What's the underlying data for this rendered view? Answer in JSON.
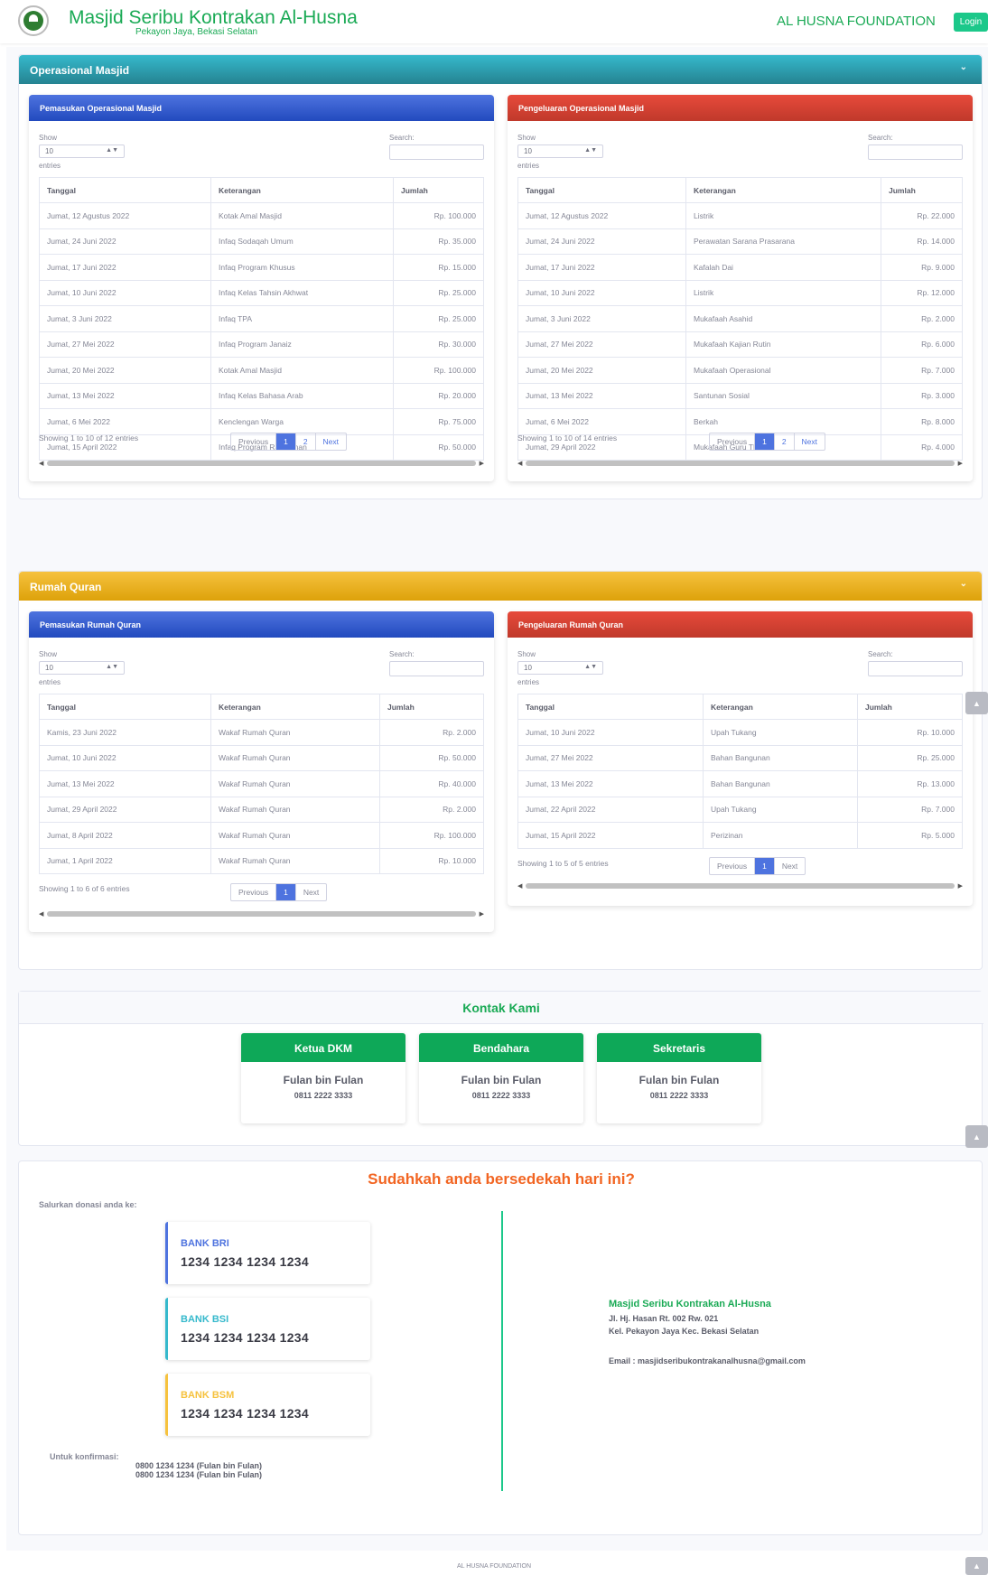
{
  "header": {
    "title": "Masjid Seribu Kontrakan Al-Husna",
    "subtitle": "Pekayon Jaya, Bekasi Selatan",
    "foundation": "AL HUSNA FOUNDATION",
    "login": "Login"
  },
  "common": {
    "show": "Show",
    "entries_value": "10",
    "entries": "entries",
    "search": "Search:",
    "col_tanggal": "Tanggal",
    "col_keterangan": "Keterangan",
    "col_jumlah": "Jumlah",
    "previous": "Previous",
    "next": "Next",
    "page1": "1",
    "page2": "2"
  },
  "operasional": {
    "title": "Operasional Masjid",
    "income": {
      "title": "Pemasukan Operasional Masjid",
      "info": "Showing 1 to 10 of 12 entries",
      "rows": [
        [
          "Jumat, 12 Agustus 2022",
          "Kotak Amal Masjid",
          "Rp. 100.000"
        ],
        [
          "Jumat, 24 Juni 2022",
          "Infaq Sodaqah Umum",
          "Rp. 35.000"
        ],
        [
          "Jumat, 17 Juni 2022",
          "Infaq Program Khusus",
          "Rp. 15.000"
        ],
        [
          "Jumat, 10 Juni 2022",
          "Infaq Kelas Tahsin Akhwat",
          "Rp. 25.000"
        ],
        [
          "Jumat, 3 Juni 2022",
          "Infaq TPA",
          "Rp. 25.000"
        ],
        [
          "Jumat, 27 Mei 2022",
          "Infaq Program Janaiz",
          "Rp. 30.000"
        ],
        [
          "Jumat, 20 Mei 2022",
          "Kotak Amal Masjid",
          "Rp. 100.000"
        ],
        [
          "Jumat, 13 Mei 2022",
          "Infaq Kelas Bahasa Arab",
          "Rp. 20.000"
        ],
        [
          "Jumat, 6 Mei 2022",
          "Kencleng​an Warga",
          "Rp. 75.000"
        ],
        [
          "Jumat, 15 April 2022",
          "Infaq Program Ramadhan",
          "Rp. 50.000"
        ]
      ]
    },
    "expense": {
      "title": "Pengeluaran Operasional Masjid",
      "info": "Showing 1 to 10 of 14 entries",
      "rows": [
        [
          "Jumat, 12 Agustus 2022",
          "Listrik",
          "Rp. 22.000"
        ],
        [
          "Jumat, 24 Juni 2022",
          "Perawatan Sarana Prasarana",
          "Rp. 14.000"
        ],
        [
          "Jumat, 17 Juni 2022",
          "Kafalah Dai",
          "Rp. 9.000"
        ],
        [
          "Jumat, 10 Juni 2022",
          "Listrik",
          "Rp. 12.000"
        ],
        [
          "Jumat, 3 Juni 2022",
          "Mukafaah Asahid",
          "Rp. 2.000"
        ],
        [
          "Jumat, 27 Mei 2022",
          "Mukafaah Kajian Rutin",
          "Rp. 6.000"
        ],
        [
          "Jumat, 20 Mei 2022",
          "Mukafaah Operasional",
          "Rp. 7.000"
        ],
        [
          "Jumat, 13 Mei 2022",
          "Santunan Sosial",
          "Rp. 3.000"
        ],
        [
          "Jumat, 6 Mei 2022",
          "Berkah",
          "Rp. 8.000"
        ],
        [
          "Jumat, 29 April 2022",
          "Mukafaah Guru TPA",
          "Rp. 4.000"
        ]
      ]
    }
  },
  "rumah_quran": {
    "title": "Rumah Quran",
    "income": {
      "title": "Pemasukan Rumah Quran",
      "info": "Showing 1 to 6 of 6 entries",
      "rows": [
        [
          "Kamis, 23 Juni 2022",
          "Wakaf Rumah Quran",
          "Rp. 2.000"
        ],
        [
          "Jumat, 10 Juni 2022",
          "Wakaf Rumah Quran",
          "Rp. 50.000"
        ],
        [
          "Jumat, 13 Mei 2022",
          "Wakaf Rumah Quran",
          "Rp. 40.000"
        ],
        [
          "Jumat, 29 April 2022",
          "Wakaf Rumah Quran",
          "Rp. 2.000"
        ],
        [
          "Jumat, 8 April 2022",
          "Wakaf Rumah Quran",
          "Rp. 100.000"
        ],
        [
          "Jumat, 1 April 2022",
          "Wakaf Rumah Quran",
          "Rp. 10.000"
        ]
      ]
    },
    "expense": {
      "title": "Pengeluaran Rumah Quran",
      "info": "Showing 1 to 5 of 5 entries",
      "rows": [
        [
          "Jumat, 10 Juni 2022",
          "Upah Tukang",
          "Rp. 10.000"
        ],
        [
          "Jumat, 27 Mei 2022",
          "Bahan Bangunan",
          "Rp. 25.000"
        ],
        [
          "Jumat, 13 Mei 2022",
          "Bahan Bangunan",
          "Rp. 13.000"
        ],
        [
          "Jumat, 22 April 2022",
          "Upah Tukang",
          "Rp. 7.000"
        ],
        [
          "Jumat, 15 April 2022",
          "Perizinan",
          "Rp. 5.000"
        ]
      ]
    }
  },
  "contact": {
    "title": "Kontak Kami",
    "cards": [
      {
        "role": "Ketua DKM",
        "name": "Fulan bin Fulan",
        "phone": "0811 2222 3333"
      },
      {
        "role": "Bendahara",
        "name": "Fulan bin Fulan",
        "phone": "0811 2222 3333"
      },
      {
        "role": "Sekretaris",
        "name": "Fulan bin Fulan",
        "phone": "0811 2222 3333"
      }
    ]
  },
  "donation": {
    "title": "Sudahkah anda bersedekah hari ini?",
    "channel_label": "Salurkan donasi anda ke:",
    "banks": [
      {
        "name": "BANK BRI",
        "number": "1234 1234 1234 1234",
        "color": "#4e73df"
      },
      {
        "name": "BANK BSI",
        "number": "1234 1234 1234 1234",
        "color": "#36b9cc"
      },
      {
        "name": "BANK BSM",
        "number": "1234 1234 1234 1234",
        "color": "#f6c23e"
      }
    ],
    "confirm_label": "Untuk konfirmasi:",
    "confirm_1": "0800 1234 1234 (Fulan bin Fulan)",
    "confirm_2": "0800 1234 1234 (Fulan bin Fulan)",
    "org_name": "Masjid Seribu Kontrakan Al-Husna",
    "address_1": "Jl. Hj. Hasan Rt. 002 Rw. 021",
    "address_2": "Kel. Pekayon Jaya Kec. Bekasi Selatan",
    "email": "Email : masjidseribukontrakanalhusna@gmail.com"
  },
  "footer": {
    "text": "AL HUSNA FOUNDATION"
  },
  "colors": {
    "brand": "#1aaa55",
    "primary": "#4e73df",
    "danger": "#e74a3b",
    "info": "#36b9cc",
    "warning": "#f6c23e",
    "orange": "#f26522"
  }
}
